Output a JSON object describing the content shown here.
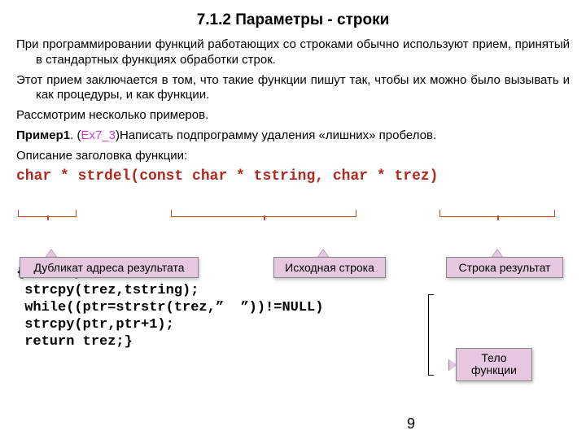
{
  "heading": "7.1.2  Параметры - строки",
  "paragraphs": {
    "p1": "При программировании функций работающих со строками обычно используют прием, принятый в стандартных функциях обработки строк.",
    "p2": "Этот прием заключается в том, что такие функции пишут так, чтобы их можно было вызывать и как процедуры, и как функции.",
    "p3": "Рассмотрим несколько примеров.",
    "p4_pre": "Пример1",
    "p4_ex": "Ex7_3",
    "p4_post": ")Написать подпрограмму удаления «лишних» пробелов.",
    "p5": "Описание заголовка функции:"
  },
  "signature": "char * strdel(const char * tstring, char * trez)",
  "code": {
    "l1": "{char *ptr;",
    "l2": " strcpy(trez,tstring);",
    "l3": " while((ptr=strstr(trez,”  ”))!=NULL)",
    "l4": " strcpy(ptr,ptr+1);",
    "l5": " return trez;}"
  },
  "callouts": {
    "ret": "Дубликат адреса результата",
    "src": "Исходная строка",
    "res": "Строка результат",
    "body": "Тело функции"
  },
  "pagenum": "9"
}
